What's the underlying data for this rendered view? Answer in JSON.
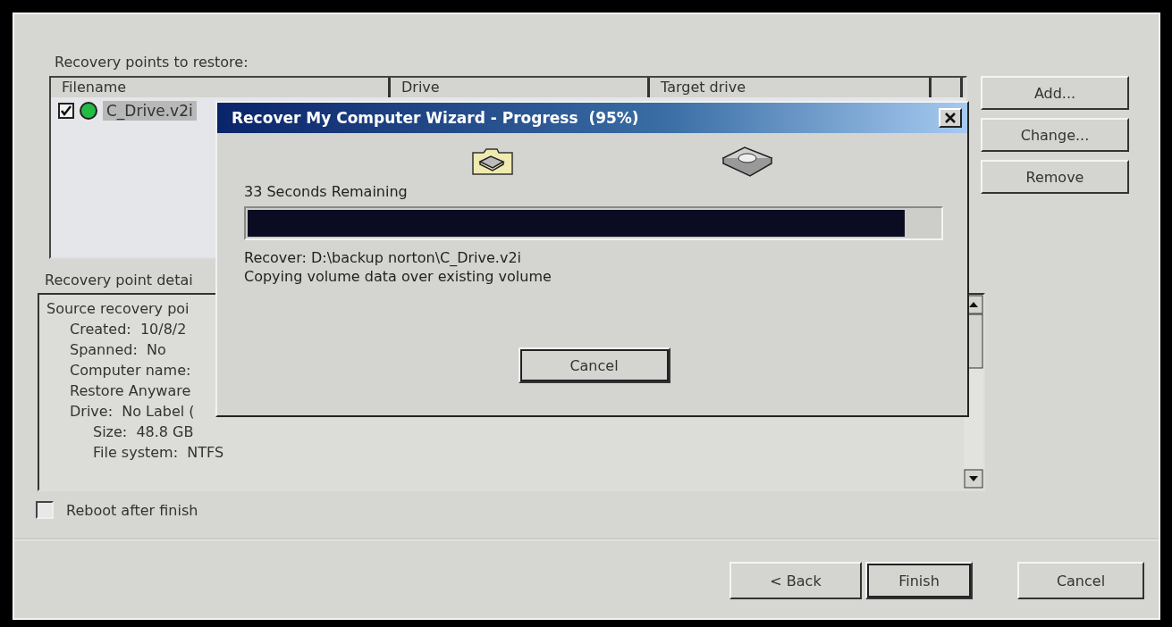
{
  "window": {
    "list_label": "Recovery points to restore:",
    "columns": [
      "Filename",
      "Drive",
      "Target drive"
    ],
    "rows": [
      {
        "checked": true,
        "color": "#22bb44",
        "filename": "C_Drive.v2i",
        "selected": true
      }
    ],
    "side_buttons": [
      "Add...",
      "Change...",
      "Remove"
    ],
    "details_label": "Recovery point detai",
    "details": [
      {
        "text": "Source recovery poi",
        "children": [
          {
            "text": "Created:  10/8/2"
          },
          {
            "text": "Spanned:  No"
          },
          {
            "text": "Computer name:"
          },
          {
            "text": "Restore Anyware"
          },
          {
            "text": "Drive:  No Label (",
            "children": [
              {
                "text": "Size:  48.8 GB"
              },
              {
                "text": "File system:  NTFS"
              }
            ]
          }
        ]
      }
    ],
    "reboot": {
      "label": "Reboot after finish",
      "checked": false
    },
    "nav_buttons": [
      {
        "label": "< Back",
        "default": false
      },
      {
        "label": "Finish",
        "default": true
      },
      {
        "label": "Cancel",
        "default": false
      }
    ]
  },
  "dialog": {
    "title": "Recover My Computer Wizard - Progress  (95%)",
    "time_remaining": "33 Seconds Remaining",
    "progress": {
      "level": 0.95
    },
    "source": "Recover: D:\\backup norton\\C_Drive.v2i",
    "status": "Copying volume data over existing volume",
    "cancel": "Cancel"
  }
}
